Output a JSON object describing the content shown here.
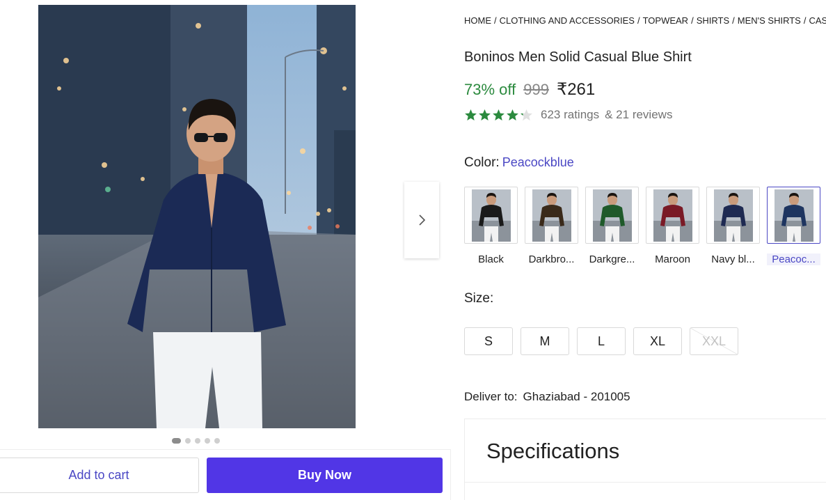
{
  "breadcrumb": [
    "HOME",
    "CLOTHING AND ACCESSORIES",
    "TOPWEAR",
    "SHIRTS",
    "MEN'S SHIRTS",
    "CASUAL SHIRTS"
  ],
  "product": {
    "title": "Boninos Men Solid Casual Blue Shirt",
    "discount": "73% off",
    "mrp": "999",
    "price": "₹261",
    "rating": 4.2,
    "ratings_text": "623 ratings",
    "reviews_text": "& 21 reviews"
  },
  "color": {
    "label": "Color:",
    "selected": "Peacockblue",
    "options": [
      {
        "name": "Black",
        "hex": "#1a1a1a"
      },
      {
        "name": "Darkbro...",
        "hex": "#3a2a1a"
      },
      {
        "name": "Darkgre...",
        "hex": "#1f5a2a"
      },
      {
        "name": "Maroon",
        "hex": "#7a1a26"
      },
      {
        "name": "Navy bl...",
        "hex": "#1e2a52"
      },
      {
        "name": "Peacoc...",
        "hex": "#1e3560"
      }
    ]
  },
  "size": {
    "label": "Size:",
    "options": [
      {
        "label": "S",
        "available": true
      },
      {
        "label": "M",
        "available": true
      },
      {
        "label": "L",
        "available": true
      },
      {
        "label": "XL",
        "available": true
      },
      {
        "label": "XXL",
        "available": false
      }
    ]
  },
  "delivery": {
    "label": "Deliver to:",
    "location": "Ghaziabad - 201005"
  },
  "specifications": {
    "title": "Specifications"
  },
  "actions": {
    "add_to_cart": "Add to cart",
    "buy_now": "Buy Now"
  },
  "gallery": {
    "image_count": 5,
    "active_index": 0
  },
  "colors": {
    "accent": "#4a47c4",
    "buy_button": "#5136e6",
    "discount": "#2b8a3e",
    "star": "#2b8a3e"
  }
}
